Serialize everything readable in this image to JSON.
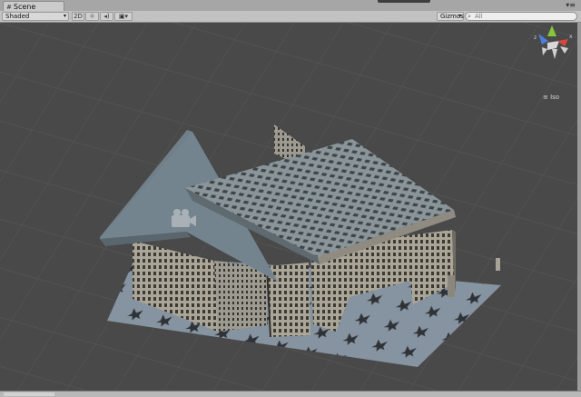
{
  "tab": {
    "label": "Scene",
    "icon": "scene-grid-icon"
  },
  "toolbar": {
    "shading_mode": "Shaded",
    "mode_2d": "2D",
    "gizmos_label": "Gizmos",
    "search_placeholder": "All"
  },
  "gizmo": {
    "projection_label": "Iso"
  },
  "colors": {
    "tab_bar": "#a6a6a6",
    "toolbar": "#c2c2c2",
    "viewport": "#494949",
    "roof": "#6c7b83",
    "building": "#9a958a",
    "ground": "#7f8a93",
    "gizmo_y": "#86c63c",
    "gizmo_x": "#d8463c",
    "gizmo_z": "#4d7ed8"
  }
}
